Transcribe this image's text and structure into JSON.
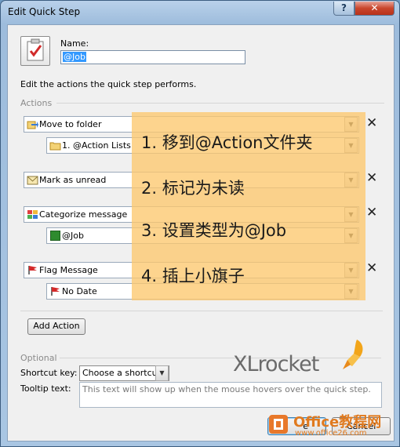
{
  "window": {
    "title": "Edit Quick Step"
  },
  "form": {
    "name_label": "Name:",
    "name_value": "@Job",
    "description": "Edit the actions the quick step performs.",
    "actions_section": "Actions"
  },
  "actions": [
    {
      "label": "Move to folder",
      "icon": "move-to-folder-icon",
      "sub": "1. @Action Lists",
      "sub_icon": "folder-icon"
    },
    {
      "label": "Mark as unread",
      "icon": "envelope-unread-icon"
    },
    {
      "label": "Categorize message",
      "icon": "category-grid-icon",
      "sub": "@Job",
      "sub_color": "#2e8b2e"
    },
    {
      "label": "Flag Message",
      "icon": "red-flag-icon",
      "sub": "No Date",
      "sub_icon": "red-flag-icon"
    }
  ],
  "annotations": [
    "1. 移到@Action文件夹",
    "2. 标记为未读",
    "3. 设置类型为@Job",
    "4. 插上小旗子"
  ],
  "add_action_label": "Add Action",
  "optional": {
    "section": "Optional",
    "shortcut_label": "Shortcut key:",
    "shortcut_value": "Choose a shortcut",
    "tooltip_label": "Tooltip text:",
    "tooltip_value": "This text will show up when the mouse hovers over the quick step."
  },
  "footer_buttons": {
    "save_partial": "e",
    "cancel_partial": "Cancel"
  },
  "logo": {
    "text": "XLrocket"
  },
  "watermark": {
    "brand": "Office教程网",
    "url": "www.office26.com"
  },
  "colors": {
    "overlay": "#fcc86e",
    "overlay_alpha": 0.78,
    "title_close": "#c9462c"
  }
}
